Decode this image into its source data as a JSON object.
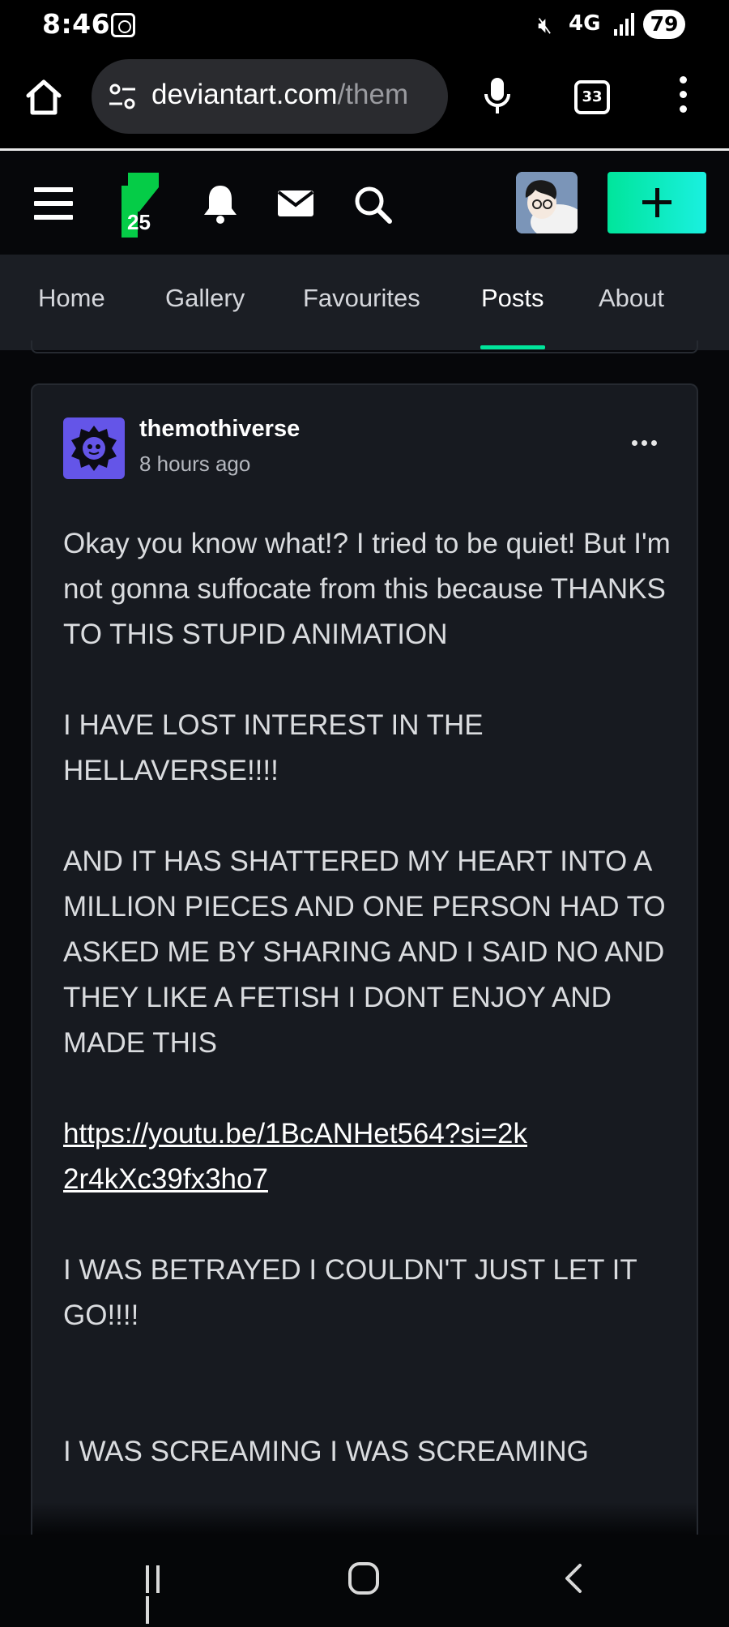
{
  "status_bar": {
    "time": "8:46",
    "network": "4G",
    "battery": "79"
  },
  "browser": {
    "url_domain": "deviantart.com",
    "url_path": "/them",
    "tab_count": "33"
  },
  "nav": {
    "logo_badge": "25"
  },
  "profile_tabs": [
    {
      "label": "Home",
      "active": false
    },
    {
      "label": "Gallery",
      "active": false
    },
    {
      "label": "Favourites",
      "active": false
    },
    {
      "label": "Posts",
      "active": true
    },
    {
      "label": "About",
      "active": false
    }
  ],
  "post": {
    "author": "themothiverse",
    "time_ago": "8 hours ago",
    "paragraph1": "Okay you know what!? I tried to be quiet! But I'm not gonna suffocate from this because THANKS TO THIS STUPID ANIMATION",
    "paragraph2": "I HAVE LOST INTEREST IN THE HELLAVERSE!!!!",
    "paragraph3": "AND IT HAS SHATTERED MY HEART INTO A MILLION PIECES AND ONE PERSON HAD TO ASKED ME BY SHARING AND I SAID NO AND THEY LIKE A FETISH I DONT ENJOY AND MADE THIS",
    "link": "https://youtu.be/1BcANHet564?si=2k2r4kXc39fx3ho7",
    "paragraph4": "I WAS BETRAYED I COULDN'T JUST LET IT GO!!!!",
    "paragraph5": "I WAS SCREAMING I WAS SCREAMING"
  },
  "colors": {
    "accent": "#00e59b",
    "card_bg": "#171a20",
    "tab_bar_bg": "#1b1e24",
    "avatar_purple": "#6455e8"
  }
}
